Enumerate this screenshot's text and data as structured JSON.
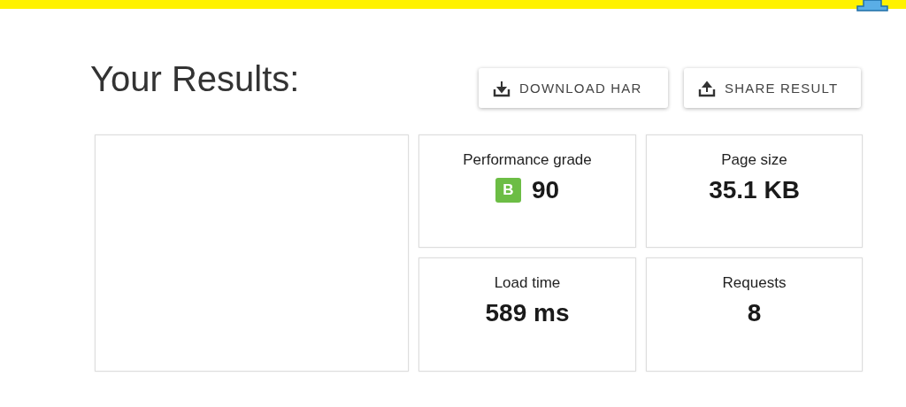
{
  "title": "Your Results:",
  "buttons": [
    {
      "label": "DOWNLOAD HAR",
      "kind": "download"
    },
    {
      "label": "SHARE RESULT",
      "kind": "share"
    }
  ],
  "cards": [
    {
      "label": "Performance grade",
      "value": "90",
      "kind": "grade",
      "grade": "B"
    },
    {
      "label": "Page size",
      "value": "35.1 KB",
      "kind": "plain"
    },
    {
      "label": "Load time",
      "value": "589 ms",
      "kind": "plain"
    },
    {
      "label": "Requests",
      "value": "8",
      "kind": "plain"
    }
  ]
}
